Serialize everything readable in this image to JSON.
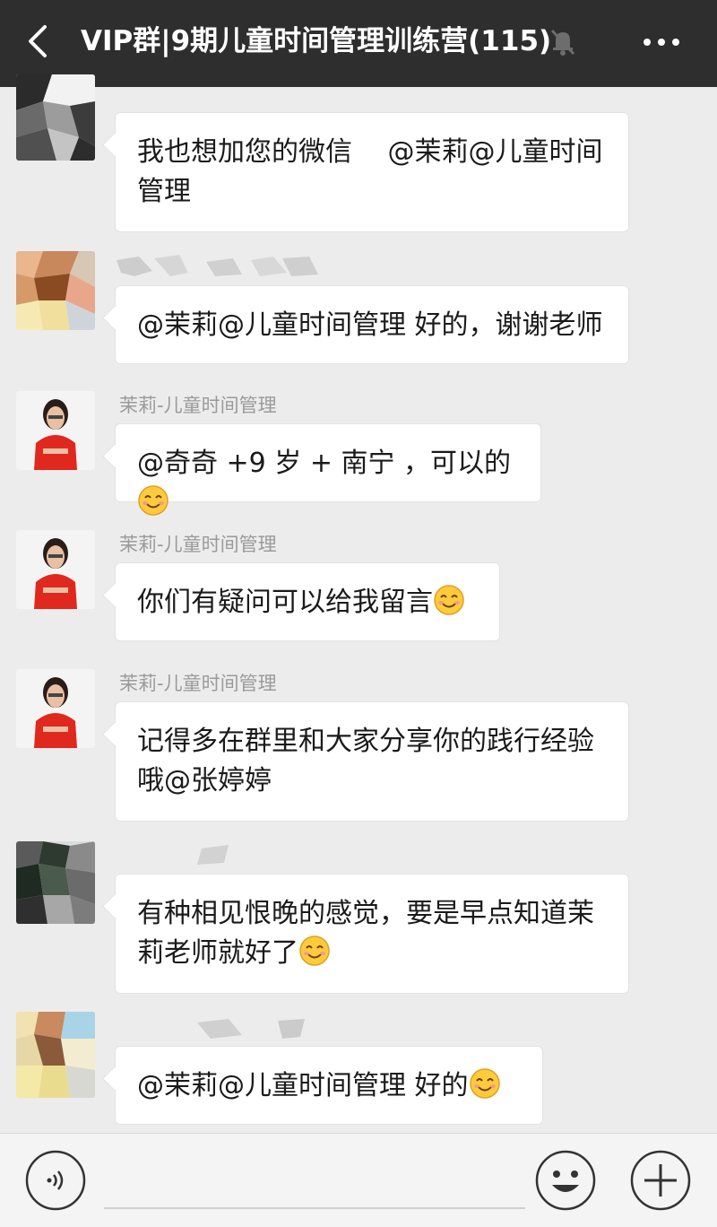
{
  "header": {
    "title": "VIP群|9期儿童时间管理训练营(115)"
  },
  "messages": [
    {
      "sender": "",
      "text": "我也想加您的微信　 @茉莉@儿童时间管理",
      "emoji": false
    },
    {
      "sender": "",
      "text": "@茉莉@儿童时间管理  好的，谢谢老师",
      "emoji": false
    },
    {
      "sender": "茉莉-儿童时间管理",
      "text": "@奇奇 +9 岁 + 南宁 ，可以的",
      "emoji": true
    },
    {
      "sender": "茉莉-儿童时间管理",
      "text": "你们有疑问可以给我留言",
      "emoji": true
    },
    {
      "sender": "茉莉-儿童时间管理",
      "text": "记得多在群里和大家分享你的践行经验哦@张婷婷",
      "emoji": false
    },
    {
      "sender": "",
      "text": "有种相见恨晚的感觉，要是早点知道茉莉老师就好了",
      "emoji": true
    },
    {
      "sender": "",
      "text": "@茉莉@儿童时间管理  好的",
      "emoji": true
    }
  ],
  "input": {
    "placeholder": ""
  },
  "icons": {
    "back": "chevron-left-icon",
    "mute": "bell-off-icon",
    "more": "more-dots-icon",
    "voice": "voice-icon",
    "emoji": "smiley-icon",
    "plus": "plus-icon"
  },
  "colors": {
    "header_bg": "#2e2e2e",
    "chat_bg": "#ececec",
    "bubble_bg": "#ffffff"
  }
}
